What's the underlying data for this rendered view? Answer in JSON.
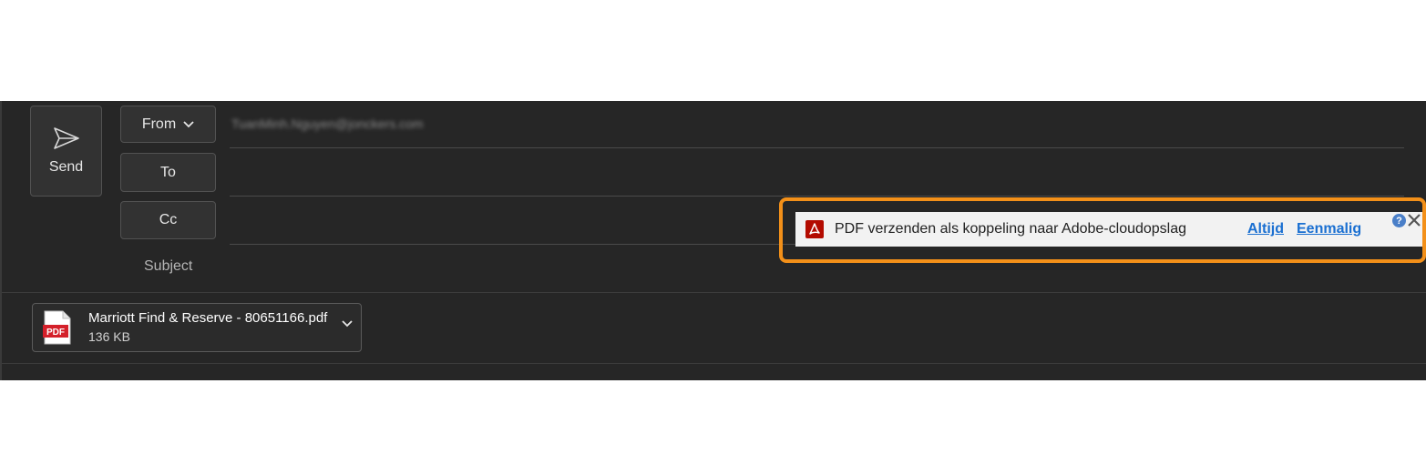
{
  "compose": {
    "send_label": "Send",
    "from_label": "From",
    "to_label": "To",
    "cc_label": "Cc",
    "subject_label": "Subject",
    "from_value": "TuanMinh.Nguyen@jonckers.com",
    "to_value": "",
    "cc_value": "",
    "subject_value": ""
  },
  "attachment": {
    "name": "Marriott Find & Reserve - 80651166.pdf",
    "size": "136 KB",
    "icon": "pdf-file-icon"
  },
  "adobe_bar": {
    "message": "PDF verzenden als koppeling naar Adobe-cloudopslag",
    "always_label": "Altijd",
    "once_label": "Eenmalig",
    "help_symbol": "?",
    "icon": "adobe-acrobat-icon"
  },
  "colors": {
    "compose_bg": "#262626",
    "highlight": "#f39019",
    "link": "#1a6fd1",
    "pdf_red": "#d4202a"
  }
}
